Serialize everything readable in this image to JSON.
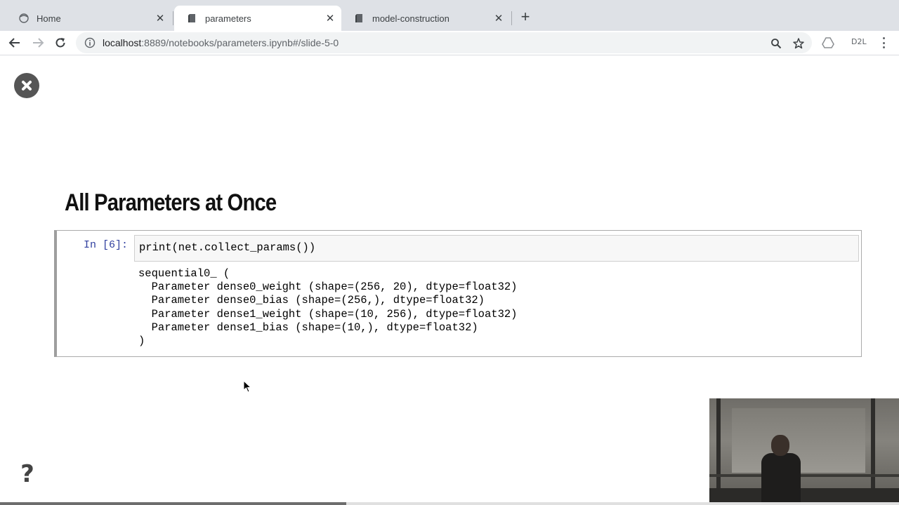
{
  "browser": {
    "tabs": [
      {
        "label": "Home",
        "active": false,
        "icon": "jupyter-icon"
      },
      {
        "label": "parameters",
        "active": true,
        "icon": "notebook-icon"
      },
      {
        "label": "model-construction",
        "active": false,
        "icon": "notebook-icon"
      }
    ],
    "new_tab_symbol": "+",
    "address": {
      "host": "localhost",
      "rest": ":8889/notebooks/parameters.ipynb#/slide-5-0"
    },
    "extension_label": "D2L"
  },
  "slide": {
    "title": "All Parameters at Once",
    "cell": {
      "prompt": "In [6]:",
      "code": "print(net.collect_params())",
      "output_lines": [
        "sequential0_ (",
        "  Parameter dense0_weight (shape=(256, 20), dtype=float32)",
        "  Parameter dense0_bias (shape=(256,), dtype=float32)",
        "  Parameter dense1_weight (shape=(10, 256), dtype=float32)",
        "  Parameter dense1_bias (shape=(10,), dtype=float32)",
        ")"
      ]
    },
    "help_symbol": "?",
    "progress_fraction": 0.385
  },
  "colors": {
    "tabstrip_bg": "#dee1e6",
    "prompt_color": "#303f9f",
    "progress_fill": "#6d6d6d"
  }
}
